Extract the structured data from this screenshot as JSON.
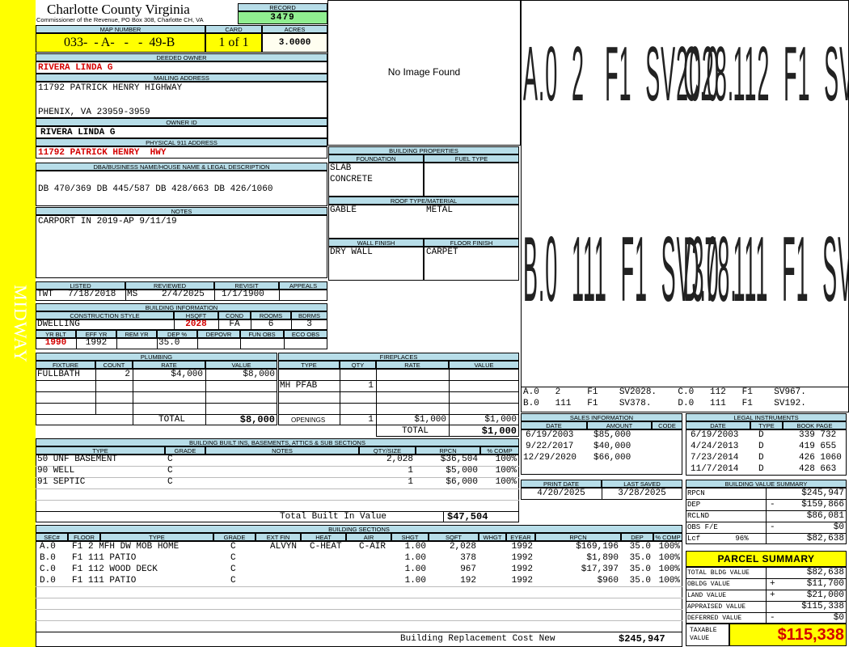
{
  "side_label": "MIDWAY",
  "header": {
    "county": "Charlotte County Virginia",
    "commissioner": "Commissioner of the Revenue, PO Box 308, Charlotte CH, VA",
    "record_label": "RECORD",
    "record_value": "3479",
    "map_number_label": "MAP NUMBER",
    "map_number_value": "033-  - A-   -   -  49-B",
    "card_label": "CARD",
    "card_value": "1 of 1",
    "acres_label": "ACRES",
    "acres_value": "3.0000"
  },
  "owner": {
    "deeded_owner_label": "DEEDED OWNER",
    "deeded_owner": "RIVERA LINDA G",
    "mailing_label": "MAILING ADDRESS",
    "mailing_line1": "11792 PATRICK HENRY HIGHWAY",
    "mailing_line2": "PHENIX, VA 23959-3959",
    "owner_id_label": "OWNER ID",
    "owner_id": "RIVERA LINDA G",
    "physical_label": "PHYSICAL 911 ADDRESS",
    "physical": "11792 PATRICK HENRY  HWY",
    "dba_label": "DBA/BUSINESS NAME/HOUSE NAME & LEGAL DESCRIPTION",
    "dba": "DB 470/369 DB 445/587 DB 428/663 DB 426/1060",
    "notes_label": "NOTES",
    "notes": "CARPORT IN 2019-AP 9/11/19"
  },
  "image_placeholder": "No Image Found",
  "building_properties": {
    "title": "BUILDING PROPERTIES",
    "foundation_label": "FOUNDATION",
    "foundation_1": "SLAB",
    "foundation_2": "CONCRETE",
    "fuel_label": "FUEL TYPE",
    "fuel": "",
    "roof_label": "ROOF TYPE/MATERIAL",
    "roof_type": "GABLE",
    "roof_material": "METAL",
    "wall_label": "WALL FINISH",
    "wall": "DRY WALL",
    "floor_label": "FLOOR FINISH",
    "floor": "CARPET"
  },
  "sketch": {
    "row1": [
      "A.0  2   F1  SV2028.",
      "C.0  112  F1  SV967."
    ],
    "row2": [
      "B.0  111  F1  SV378.",
      "D.0  111  F1  SV192."
    ],
    "legend": [
      "A.0   2     F1    SV2028.    C.0   112   F1    SV967.",
      "B.0   111   F1    SV378.     D.0   111   F1    SV192."
    ]
  },
  "listed": {
    "listed_label": "LISTED",
    "listed_by": "TWT",
    "listed_date": "7/18/2018",
    "reviewed_label": "REVIEWED",
    "reviewed_by": "MS",
    "reviewed_date": "2/4/2025",
    "revisit_label": "REVISIT",
    "revisit_date": "1/1/1900",
    "appeals_label": "APPEALS",
    "appeals": ""
  },
  "building_info": {
    "title": "BUILDING INFORMATION",
    "style_label": "CONSTRUCTION STYLE",
    "style": "DWELLING",
    "hsqft_label": "HSQFT",
    "hsqft": "2028",
    "cond_label": "COND",
    "cond": "FA",
    "rooms_label": "ROOMS",
    "rooms": "6",
    "bdrms_label": "BDRMS",
    "bdrms": "3",
    "yrblt_label": "YR BLT",
    "yrblt": "1990",
    "effyr_label": "EFF YR",
    "effyr": "1992",
    "remyr_label": "REM YR",
    "remyr": "",
    "dep_label": "DEP %",
    "dep": "35.0",
    "depovr_label": "DEPOVR",
    "depovr": "",
    "funobs_label": "FUN OBS",
    "funobs": "",
    "ecoobs_label": "ECO OBS",
    "ecoobs": ""
  },
  "plumbing": {
    "title": "PLUMBING",
    "headers": [
      "FIXTURE",
      "COUNT",
      "RATE",
      "VALUE"
    ],
    "rows": [
      [
        "FULLBATH",
        "2",
        "$4,000",
        "$8,000"
      ]
    ],
    "total_label": "TOTAL",
    "total": "$8,000"
  },
  "fireplaces": {
    "title": "FIREPLACES",
    "headers": [
      "TYPE",
      "QTY",
      "RATE",
      "VALUE"
    ],
    "rows": [
      [
        "MH PFAB",
        "1",
        "",
        ""
      ]
    ],
    "openings_label": "OPENINGS",
    "openings_qty": "1",
    "openings_rate": "$1,000",
    "openings_value": "$1,000",
    "total_label": "TOTAL",
    "total": "$1,000"
  },
  "built_ins": {
    "title": "BUILDING BUILT INS, BASEMENTS, ATTICS & SUB SECTIONS",
    "headers": [
      "TYPE",
      "GRADE",
      "NOTES",
      "QTY/SIZE",
      "RPCN",
      "% COMP"
    ],
    "rows": [
      [
        "50 UNF BASEMENT",
        "C",
        "",
        "2,028",
        "$36,504",
        "100%"
      ],
      [
        "90 WELL",
        "C",
        "",
        "1",
        "$5,000",
        "100%"
      ],
      [
        "91 SEPTIC",
        "C",
        "",
        "1",
        "$6,000",
        "100%"
      ]
    ],
    "total_label": "Total Built In Value",
    "total": "$47,504"
  },
  "sales": {
    "title": "SALES INFORMATION",
    "headers": [
      "DATE",
      "AMOUNT",
      "CODE"
    ],
    "rows": [
      [
        "6/19/2003",
        "$85,000",
        ""
      ],
      [
        "9/22/2017",
        "$40,000",
        ""
      ],
      [
        "12/29/2020",
        "$66,000",
        ""
      ]
    ]
  },
  "legal": {
    "title": "LEGAL INSTRUMENTS",
    "headers": [
      "DATE",
      "TYPE",
      "BOOK PAGE"
    ],
    "rows": [
      [
        "6/19/2003",
        "D",
        "339 732"
      ],
      [
        "4/24/2013",
        "D",
        "419 655"
      ],
      [
        "7/23/2014",
        "D",
        "426 1060"
      ],
      [
        "11/7/2014",
        "D",
        "428 663"
      ]
    ]
  },
  "print": {
    "print_label": "PRINT DATE",
    "print_date": "4/20/2025",
    "saved_label": "LAST SAVED",
    "saved_date": "3/28/2025"
  },
  "value_summary": {
    "title": "BUILDING VALUE SUMMARY",
    "rows": [
      [
        "RPCN",
        "",
        "$245,947"
      ],
      [
        "DEP",
        "-",
        "$159,866"
      ],
      [
        "RCLND",
        "",
        "$86,081"
      ],
      [
        "OBS F/E",
        "-",
        "$0"
      ],
      [
        "Lcf        96%",
        "",
        "$82,638"
      ]
    ]
  },
  "parcel_summary": {
    "title": "PARCEL SUMMARY",
    "rows": [
      [
        "TOTAL BLDG VALUE",
        "",
        "$82,638"
      ],
      [
        "OBLDG VALUE",
        "+",
        "$11,700"
      ],
      [
        "LAND VALUE",
        "+",
        "$21,000"
      ],
      [
        "APPRAISED VALUE",
        "",
        "$115,338"
      ],
      [
        "DEFERRED VALUE",
        "-",
        "$0"
      ]
    ],
    "taxable_label": "TAXABLE VALUE",
    "taxable": "$115,338"
  },
  "sections": {
    "title": "BUILDING SECTIONS",
    "headers": [
      "SEC#",
      "FLOOR",
      "TYPE",
      "GRADE",
      "EXT FIN",
      "HEAT",
      "AIR",
      "SHGT",
      "SQFT",
      "WHGT",
      "EYEAR",
      "RPCN",
      "DEP",
      "% COMP"
    ],
    "rows": [
      [
        "A.0",
        "F1",
        "2 MFH DW MOB HOME",
        "C",
        "ALVYN",
        "C-HEAT",
        "C-AIR",
        "1.00",
        "2,028",
        "",
        "1992",
        "$169,196",
        "35.0",
        "100%"
      ],
      [
        "B.0",
        "F1",
        "111 PATIO",
        "C",
        "",
        "",
        "",
        "1.00",
        "378",
        "",
        "1992",
        "$1,890",
        "35.0",
        "100%"
      ],
      [
        "C.0",
        "F1",
        "112 WOOD DECK",
        "C",
        "",
        "",
        "",
        "1.00",
        "967",
        "",
        "1992",
        "$17,397",
        "35.0",
        "100%"
      ],
      [
        "D.0",
        "F1",
        "111 PATIO",
        "C",
        "",
        "",
        "",
        "1.00",
        "192",
        "",
        "1992",
        "$960",
        "35.0",
        "100%"
      ]
    ],
    "total_label": "Building Replacement Cost New",
    "total": "$245,947"
  }
}
